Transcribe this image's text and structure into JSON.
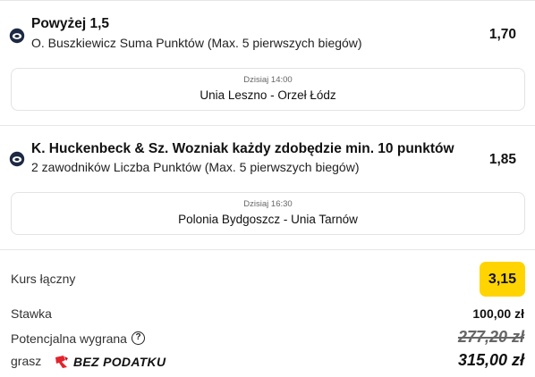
{
  "bets": [
    {
      "title": "Powyżej 1,5",
      "subtitle": "O. Buszkiewicz Suma Punktów (Max. 5 pierwszych biegów)",
      "odds": "1,70",
      "event_time": "Dzisiaj 14:00",
      "event_teams": "Unia Leszno - Orzeł Łódz",
      "icon": "speedway-icon"
    },
    {
      "title": "K. Huckenbeck & Sz. Wozniak każdy zdobędzie min. 10 punktów",
      "subtitle": "2 zawodników Liczba Punktów (Max. 5 pierwszych biegów)",
      "odds": "1,85",
      "event_time": "Dzisiaj 16:30",
      "event_teams": "Polonia Bydgoszcz - Unia Tarnów",
      "icon": "speedway-icon"
    }
  ],
  "summary": {
    "total_odds_label": "Kurs łączny",
    "total_odds": "3,15",
    "stake_label": "Stawka",
    "stake": "100,00 zł",
    "potential_label": "Potencjalna wygrana",
    "potential_help": "?",
    "potential_old": "277,20 zł",
    "grasz_label": "grasz",
    "tax_free_label": "BEZ PODATKU",
    "potential_final": "315,00 zł"
  },
  "colors": {
    "accent_yellow": "#ffd400",
    "tax_logo_red": "#e3232b",
    "border": "#e3e3e3"
  }
}
